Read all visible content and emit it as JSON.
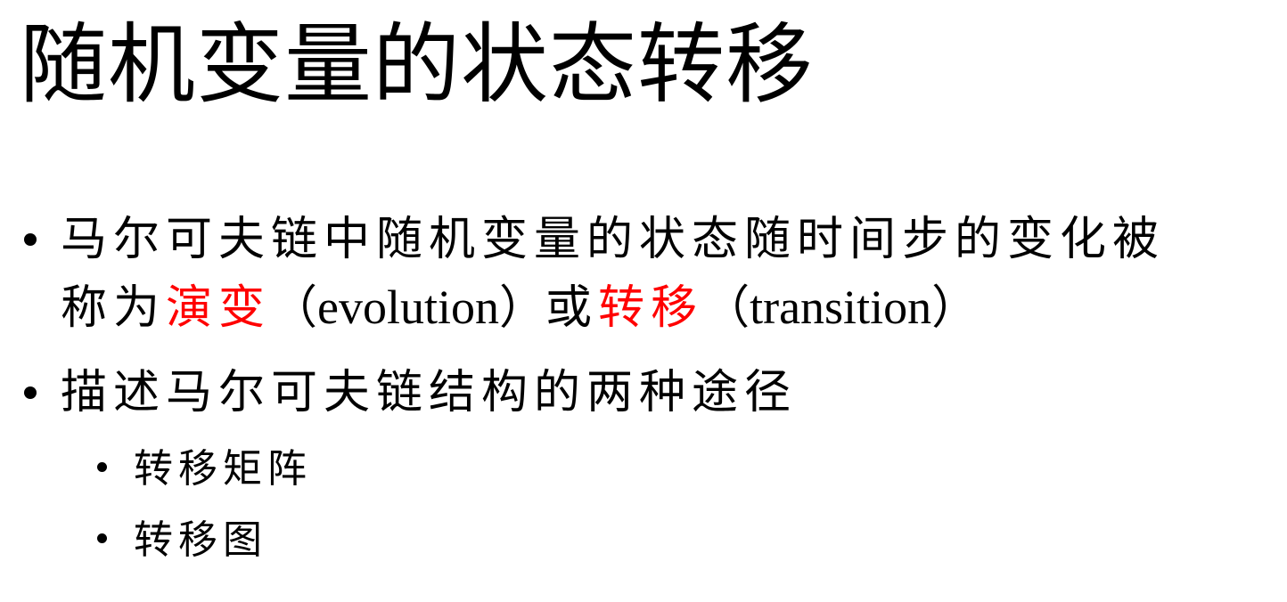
{
  "title": "随机变量的状态转移",
  "colors": {
    "text": "#000000",
    "highlight": "#ff0000",
    "background": "#ffffff"
  },
  "bullets": {
    "b1": {
      "line1": "马尔可夫链中随机变量的状态随时间步的变化被",
      "line2_prefix": "称为",
      "term1": "演变",
      "term1_open": "（",
      "term1_en": "evolution",
      "term1_close": "）",
      "connector": "或",
      "term2": "转移",
      "term2_open": "（",
      "term2_en": "transition",
      "term2_close": "）"
    },
    "b2": {
      "text": "描述马尔可夫链结构的两种途径",
      "sub": [
        "转移矩阵",
        "转移图"
      ]
    }
  }
}
